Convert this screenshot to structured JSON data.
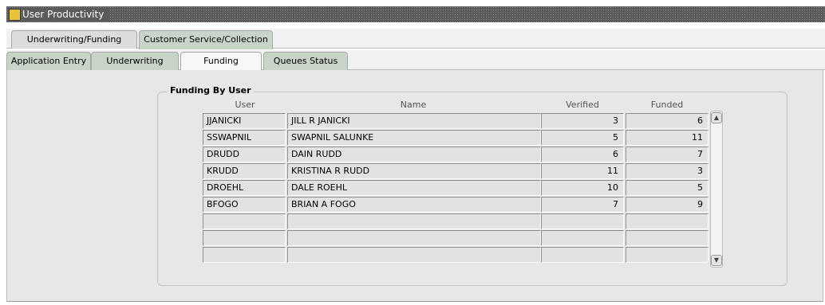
{
  "window": {
    "title": "User Productivity"
  },
  "tabs_top": [
    {
      "label": "Underwriting/Funding"
    },
    {
      "label": "Customer Service/Collection"
    }
  ],
  "tabs_sub": [
    {
      "label": "Application Entry"
    },
    {
      "label": "Underwriting"
    },
    {
      "label": "Funding"
    },
    {
      "label": "Queues Status"
    }
  ],
  "group": {
    "title": "Funding By User",
    "columns": {
      "user": "User",
      "name": "Name",
      "verified": "Verified",
      "funded": "Funded"
    }
  },
  "rows": [
    {
      "user": "JJANICKI",
      "name": "JILL R JANICKI",
      "verified": "3",
      "funded": "6"
    },
    {
      "user": "SSWAPNIL",
      "name": "SWAPNIL SALUNKE",
      "verified": "5",
      "funded": "11"
    },
    {
      "user": "DRUDD",
      "name": "DAIN RUDD",
      "verified": "6",
      "funded": "7"
    },
    {
      "user": "KRUDD",
      "name": "KRISTINA R RUDD",
      "verified": "11",
      "funded": "3"
    },
    {
      "user": "DROEHL",
      "name": "DALE  ROEHL",
      "verified": "10",
      "funded": "5"
    },
    {
      "user": "BFOGO",
      "name": "BRIAN A FOGO",
      "verified": "7",
      "funded": "9"
    },
    {
      "user": "",
      "name": "",
      "verified": "",
      "funded": ""
    },
    {
      "user": "",
      "name": "",
      "verified": "",
      "funded": ""
    },
    {
      "user": "",
      "name": "",
      "verified": "",
      "funded": ""
    }
  ],
  "icons": {
    "app": "app-window-icon",
    "scroll_up": "scroll-up-arrow-icon",
    "scroll_down": "scroll-down-arrow-icon"
  }
}
